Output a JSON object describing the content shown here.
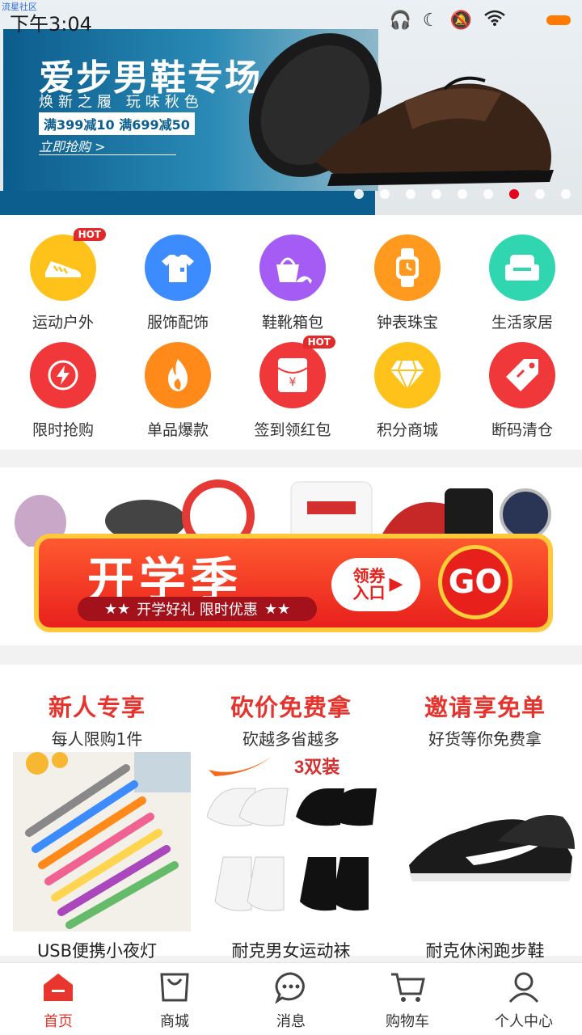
{
  "watermark": "流星社区",
  "status_bar": {
    "time": "下午3:04",
    "battery_color": "#ff7a00"
  },
  "banner": {
    "title": "爱步男鞋专场",
    "subtitle": "焕新之履 玩味秋色",
    "promo": "满399减10 满699减50",
    "cta": "立即抢购 >",
    "dot_count": 9,
    "active_dot": 6
  },
  "categories": [
    {
      "label": "运动户外",
      "icon": "sneaker-icon",
      "color": "#ffc21a",
      "hot": "HOT"
    },
    {
      "label": "服饰配饰",
      "icon": "tshirt-icon",
      "color": "#3d8cff",
      "hot": ""
    },
    {
      "label": "鞋靴箱包",
      "icon": "handbag-heel-icon",
      "color": "#a45cf5",
      "hot": ""
    },
    {
      "label": "钟表珠宝",
      "icon": "watch-icon",
      "color": "#ff9a1f",
      "hot": ""
    },
    {
      "label": "生活家居",
      "icon": "sofa-icon",
      "color": "#2fd6b0",
      "hot": ""
    },
    {
      "label": "限时抢购",
      "icon": "lightning-icon",
      "color": "#f0383a",
      "hot": ""
    },
    {
      "label": "单品爆款",
      "icon": "flame-icon",
      "color": "#ff8a1a",
      "hot": ""
    },
    {
      "label": "签到领红包",
      "icon": "red-envelope-icon",
      "color": "#f0383a",
      "hot": "HOT"
    },
    {
      "label": "积分商城",
      "icon": "diamond-icon",
      "color": "#ffc21a",
      "hot": ""
    },
    {
      "label": "断码清仓",
      "icon": "price-tag-icon",
      "color": "#f0383a",
      "hot": ""
    }
  ],
  "promo_banner": {
    "title": "开学季",
    "subtitle": "开学好礼 限时优惠",
    "stars": "★★",
    "coupon": "领券入口",
    "go": "GO"
  },
  "deals": [
    {
      "title": "新人专享",
      "subtitle": "每人限购1件",
      "product": "USB便携小夜灯"
    },
    {
      "title": "砍价免费拿",
      "subtitle": "砍越多省越多",
      "product": "耐克男女运动袜",
      "badge": "3双装"
    },
    {
      "title": "邀请享免单",
      "subtitle": "好货等你免费拿",
      "product": "耐克休闲跑步鞋"
    }
  ],
  "tabbar": {
    "active_color": "#e8352e",
    "items": [
      {
        "label": "首页",
        "icon": "home-icon",
        "active": true
      },
      {
        "label": "商城",
        "icon": "shopping-bag-icon",
        "active": false
      },
      {
        "label": "消息",
        "icon": "chat-bubble-icon",
        "active": false
      },
      {
        "label": "购物车",
        "icon": "cart-icon",
        "active": false
      },
      {
        "label": "个人中心",
        "icon": "user-icon",
        "active": false
      }
    ]
  }
}
